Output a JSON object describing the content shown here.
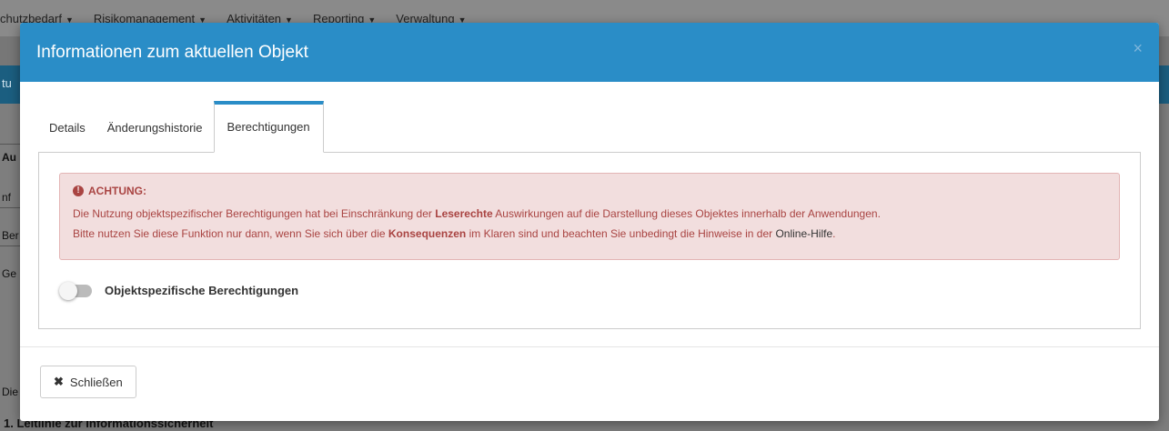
{
  "background": {
    "nav": [
      {
        "label": "chutzbedarf"
      },
      {
        "label": "Risikomanagement"
      },
      {
        "label": "Aktivitäten"
      },
      {
        "label": "Reporting"
      },
      {
        "label": "Verwaltung"
      }
    ],
    "fragments": {
      "band": "tu",
      "au": "Au",
      "inf": "nf",
      "ber": "Ber",
      "ge": "Ge",
      "die": "Die",
      "bottom": "1. Leitlinie zur Informationssicherheit"
    }
  },
  "modal": {
    "title": "Informationen zum aktuellen Objekt",
    "close_symbol": "×",
    "tabs": [
      {
        "label": "Details",
        "active": false
      },
      {
        "label": "Änderungshistorie",
        "active": false
      },
      {
        "label": "Berechtigungen",
        "active": true
      }
    ],
    "alert": {
      "icon": "exclamation-circle-icon",
      "icon_glyph": "!",
      "heading": "ACHTUNG:",
      "line1_pre": "Die Nutzung objektspezifischer Berechtigungen hat bei Einschränkung der ",
      "line1_bold": "Leserechte",
      "line1_post": " Auswirkungen auf die Darstellung dieses Objektes innerhalb der Anwendungen.",
      "line2_pre": "Bitte nutzen Sie diese Funktion nur dann, wenn Sie sich über die ",
      "line2_bold": "Konsequenzen",
      "line2_mid": " im Klaren sind und beachten Sie unbedingt die Hinweise in der ",
      "line2_link": "Online-Hilfe",
      "line2_post": "."
    },
    "toggle": {
      "label": "Objektspezifische Berechtigungen",
      "enabled": false
    },
    "footer": {
      "close_icon_glyph": "✖",
      "close_label": "Schließen"
    }
  },
  "colors": {
    "header": "#2a8dc7",
    "alert_bg": "#f2dede",
    "alert_text": "#a94442"
  }
}
